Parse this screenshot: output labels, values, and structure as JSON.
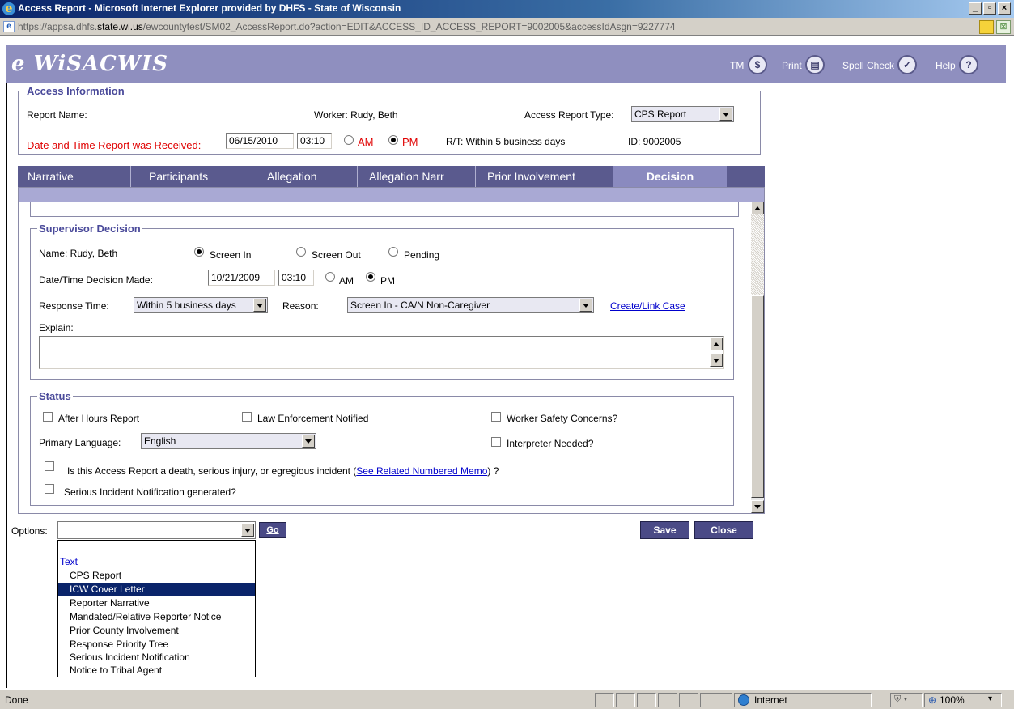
{
  "window": {
    "title": "Access Report - Microsoft Internet Explorer provided by DHFS - State of Wisconsin",
    "url_prefix": "https://appsa.dhfs.",
    "url_domain": "state.wi.us",
    "url_path": "/ewcountytest/SM02_AccessReport.do?action=EDIT&ACCESS_ID_ACCESS_REPORT=9002005&accessIdAsgn=9227774"
  },
  "header": {
    "logo": "e WiSACWIS",
    "links": [
      {
        "label": "TM",
        "icon": "tm-icon"
      },
      {
        "label": "Print",
        "icon": "print-icon"
      },
      {
        "label": "Spell Check",
        "icon": "spellcheck-icon"
      },
      {
        "label": "Help",
        "icon": "help-icon"
      }
    ]
  },
  "access_info": {
    "legend": "Access Information",
    "report_name_label": "Report Name:",
    "worker_label": "Worker: Rudy, Beth",
    "report_type_label": "Access Report Type:",
    "report_type_value": "CPS Report",
    "date_label": "Date and Time Report was Received:",
    "date_value": "06/15/2010",
    "time_value": "03:10",
    "am_label": "AM",
    "pm_label": "PM",
    "rt_label": "R/T: Within 5 business days",
    "id_label": "ID:  9002005"
  },
  "tabs": [
    {
      "label": "Narrative"
    },
    {
      "label": "Participants"
    },
    {
      "label": "Allegation"
    },
    {
      "label": "Allegation Narr"
    },
    {
      "label": "Prior Involvement"
    },
    {
      "label": "Decision",
      "active": true
    }
  ],
  "supervisor": {
    "legend": "Supervisor Decision",
    "name_label": "Name:   Rudy, Beth",
    "screen_in": "Screen In",
    "screen_out": "Screen Out",
    "pending": "Pending",
    "decision_date_label": "Date/Time Decision Made:",
    "decision_date": "10/21/2009",
    "decision_time": "03:10",
    "am_label": "AM",
    "pm_label": "PM",
    "response_label": "Response Time:",
    "response_value": "Within 5 business days",
    "reason_label": "Reason:",
    "reason_value": "Screen In - CA/N Non-Caregiver",
    "create_link": "Create/Link Case",
    "explain_label": "Explain:"
  },
  "status": {
    "legend": "Status",
    "after_hours": "After Hours Report",
    "law_enforcement": "Law Enforcement Notified",
    "worker_safety": "Worker Safety Concerns?",
    "language_label": "Primary Language:",
    "language_value": "English",
    "interpreter": "Interpreter Needed?",
    "death_question_pre": "Is this Access Report a death, serious injury, or egregious incident (",
    "death_link": "See Related Numbered Memo",
    "death_question_post": ") ?",
    "serious_incident": "Serious Incident Notification generated?"
  },
  "footer": {
    "options_label": "Options:",
    "go_label": "Go",
    "save_label": "Save",
    "close_label": "Close"
  },
  "options_dropdown": {
    "group": "Text",
    "items": [
      "CPS Report",
      "ICW Cover Letter",
      "Reporter Narrative",
      "Mandated/Relative Reporter Notice",
      "Prior County Involvement",
      "Response Priority Tree",
      "Serious Incident Notification",
      "Notice to Tribal Agent"
    ],
    "selected_index": 1
  },
  "statusbar": {
    "left": "Done",
    "zone": "Internet",
    "zoom": "100%"
  }
}
